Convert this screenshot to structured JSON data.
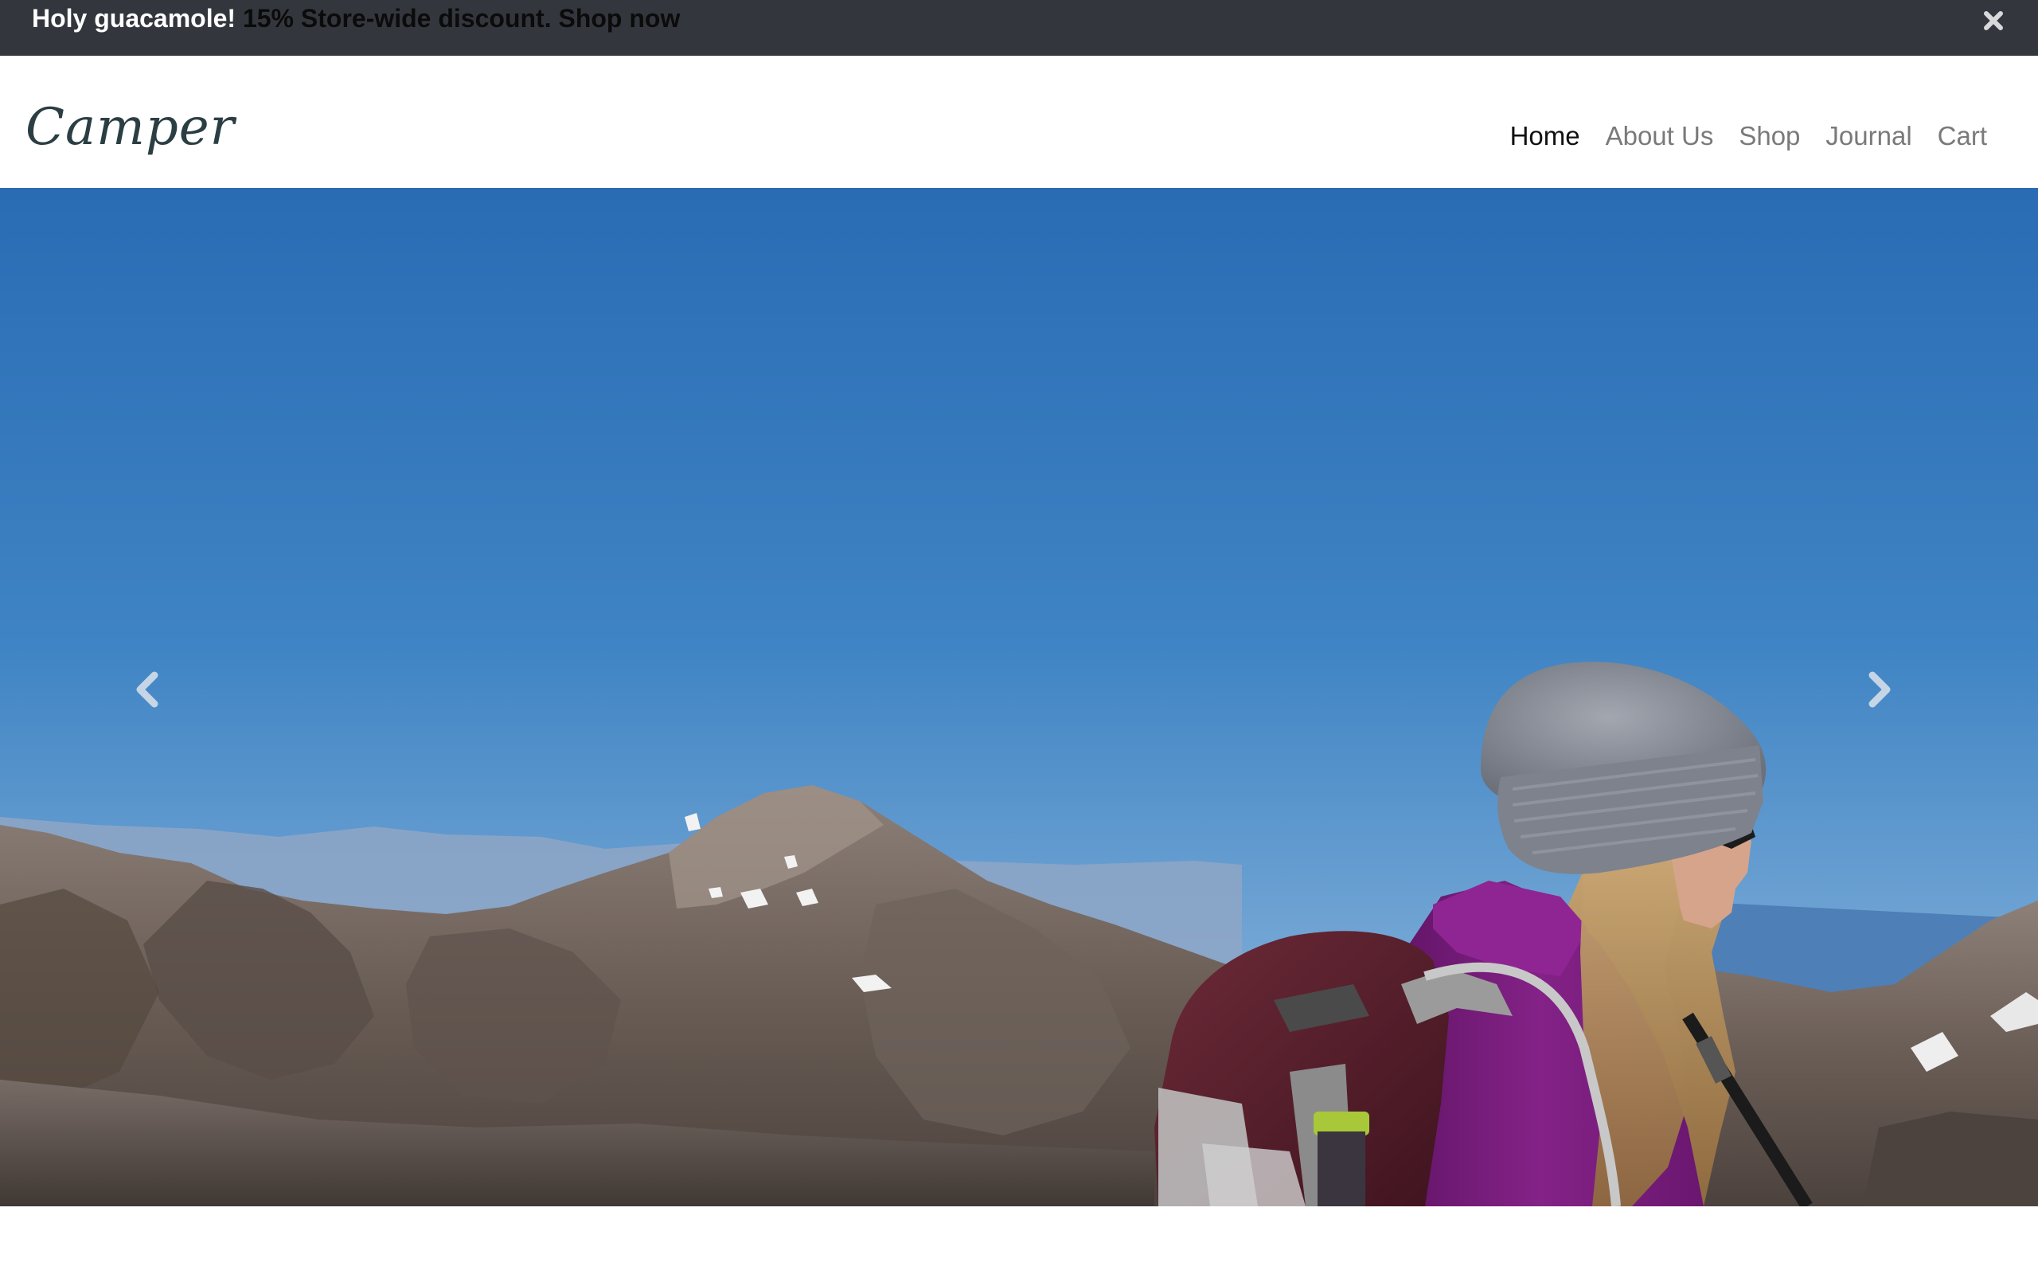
{
  "alert": {
    "strong": "Holy guacamole!",
    "message": " 15% Store-wide discount. Shop now",
    "close_icon": "close-icon"
  },
  "header": {
    "brand": "Camper",
    "nav": [
      {
        "label": "Home",
        "active": true
      },
      {
        "label": "About Us",
        "active": false
      },
      {
        "label": "Shop",
        "active": false
      },
      {
        "label": "Journal",
        "active": false
      },
      {
        "label": "Cart",
        "active": false
      }
    ]
  },
  "carousel": {
    "prev_icon": "chevron-left-icon",
    "next_icon": "chevron-right-icon",
    "slide_image": "hiker-mountain-photo"
  },
  "colors": {
    "alert_bg": "#33373d",
    "brand": "#2b3e44",
    "nav_active": "#111111",
    "nav_inactive": "#7a7a7a",
    "sky_top": "#2a6db5",
    "sky_horizon": "#86b2d8",
    "jacket": "#7d1e7e",
    "backpack": "#5e2230"
  }
}
